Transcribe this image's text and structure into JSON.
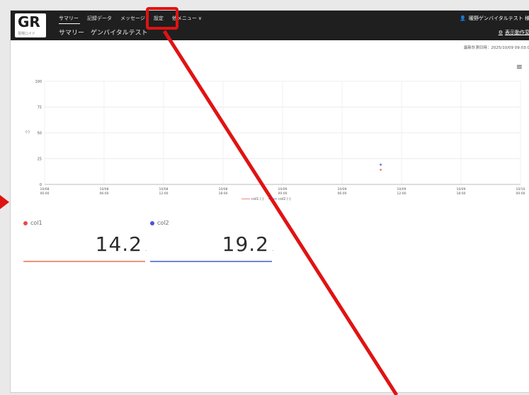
{
  "app": {
    "logo_text": "GR",
    "logo_sub": "現場ロイド"
  },
  "nav": {
    "items": [
      "サマリー",
      "記録データ",
      "メッセージ",
      "設定",
      "他メニュー"
    ],
    "more_chevron": "∨"
  },
  "header": {
    "subtitle": "サマリー　ゲンバイタルテスト",
    "user_label": "暖野ゲンバイタルテスト 様",
    "display_settings": "表示動作変",
    "updated_text": "最新計測日時：2025/10/09 09:03:0"
  },
  "chart_data": {
    "type": "line",
    "ylabel": "(-)",
    "ylim": [
      0,
      100
    ],
    "yticks": [
      0,
      25,
      50,
      75,
      100
    ],
    "x": [
      "10/08\n00:00",
      "10/08\n06:00",
      "10/08\n12:00",
      "10/08\n18:00",
      "10/09\n00:00",
      "10/09\n06:00",
      "10/09\n12:00",
      "10/09\n18:00",
      "10/10\n00:00"
    ],
    "series": [
      {
        "name": "col1 (-)",
        "color": "#f08a7a",
        "values": [
          14.2
        ]
      },
      {
        "name": "col2 (-)",
        "color": "#7a7ad8",
        "values": [
          19.2
        ]
      }
    ]
  },
  "cards": [
    {
      "label": "col1",
      "value": "14.2",
      "unit": "-",
      "color": "#e94a4a",
      "bar_color": "#f0937f"
    },
    {
      "label": "col2",
      "value": "19.2",
      "unit": "-",
      "color": "#4a56d4",
      "bar_color": "#6f86d8"
    }
  ],
  "icons": {
    "user": "user-icon",
    "gear": "gear-icon",
    "menu": "menu-icon"
  },
  "accent_red": "#e01313"
}
